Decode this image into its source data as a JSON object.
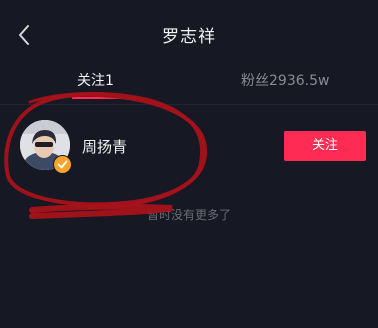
{
  "header": {
    "title": "罗志祥",
    "back_icon": "back-chevron-icon"
  },
  "tabs": [
    {
      "label": "关注1",
      "active": true
    },
    {
      "label": "粉丝2936.5w",
      "active": false
    }
  ],
  "following_list": [
    {
      "name": "周扬青",
      "avatar_icon": "avatar-photo",
      "verified_icon": "verified-check-icon",
      "action_label": "关注"
    }
  ],
  "footer_text": "暂时没有更多了",
  "colors": {
    "background": "#161823",
    "accent": "#fe2c55",
    "verified": "#f7a32d",
    "annotation": "#a8121a"
  }
}
